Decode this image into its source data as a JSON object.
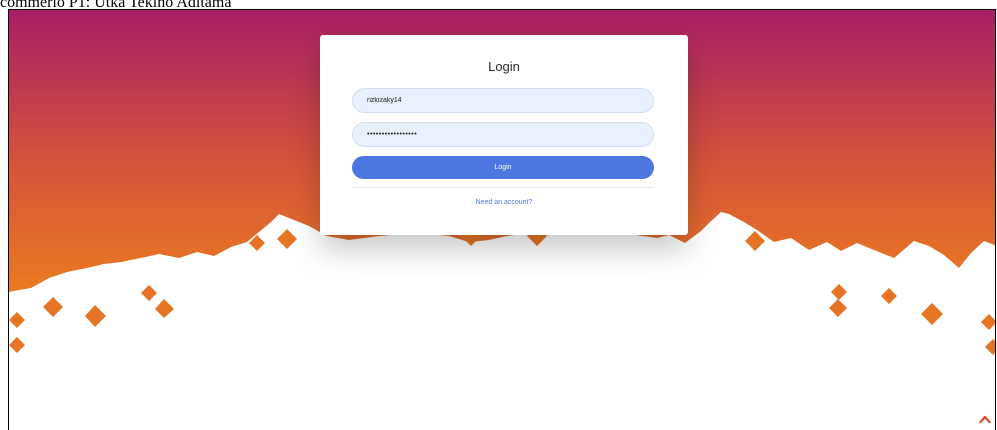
{
  "caption": "commerio P1: Utka Tekino Aditama",
  "login_card": {
    "title": "Login",
    "username_value": "rizkizaky14",
    "password_value": "•••••••••••••••••",
    "submit_label": "Login",
    "register_link": "Need an account?"
  },
  "icons": {
    "scroll_top": "chevron-up-icon"
  },
  "colors": {
    "gradient_top": "#a71f66",
    "gradient_bottom": "#ea7a20",
    "shape_orange": "#e57524",
    "button_blue": "#4e76e0",
    "input_bg": "#e8f0fe"
  }
}
